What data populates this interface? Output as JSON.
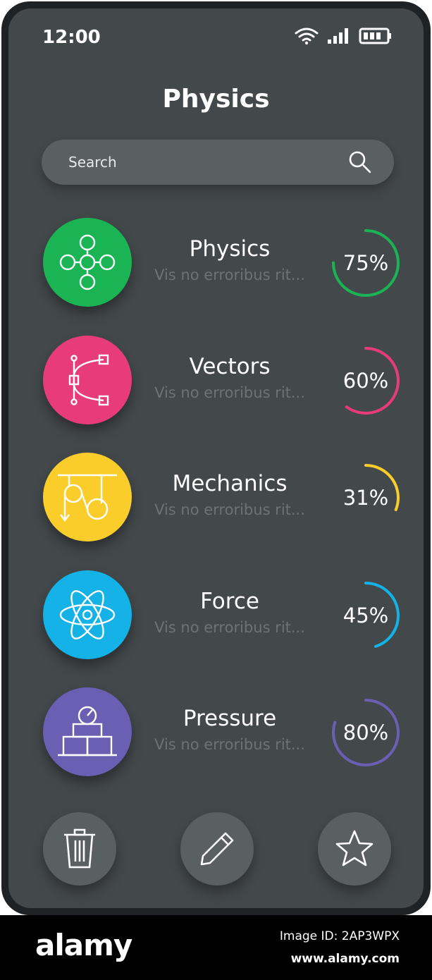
{
  "status": {
    "time": "12:00"
  },
  "title": "Physics",
  "search": {
    "label": "Search"
  },
  "items": [
    {
      "title": "Physics",
      "subtitle": "Vis no erroribus rit...",
      "percent_label": "75%",
      "percent": 75,
      "color": "#1ab454",
      "icon": "molecule-icon"
    },
    {
      "title": "Vectors",
      "subtitle": "Vis no erroribus rit...",
      "percent_label": "60%",
      "percent": 60,
      "color": "#e83c78",
      "icon": "bezier-curve-icon"
    },
    {
      "title": "Mechanics",
      "subtitle": "Vis no erroribus rit...",
      "percent_label": "31%",
      "percent": 31,
      "color": "#fbcd2b",
      "icon": "pulley-icon"
    },
    {
      "title": "Force",
      "subtitle": "Vis no erroribus rit...",
      "percent_label": "45%",
      "percent": 45,
      "color": "#14b2e6",
      "icon": "atom-icon"
    },
    {
      "title": "Pressure",
      "subtitle": "Vis no erroribus rit...",
      "percent_label": "80%",
      "percent": 80,
      "color": "#6a5fb3",
      "icon": "pressure-gauge-icon"
    }
  ],
  "actions": [
    {
      "name": "delete",
      "icon": "trash-icon"
    },
    {
      "name": "edit",
      "icon": "pencil-icon"
    },
    {
      "name": "favorite",
      "icon": "star-icon"
    }
  ],
  "footer": {
    "brand": "alamy",
    "image_id": "Image ID: 2AP3WPX",
    "url": "www.alamy.com"
  }
}
